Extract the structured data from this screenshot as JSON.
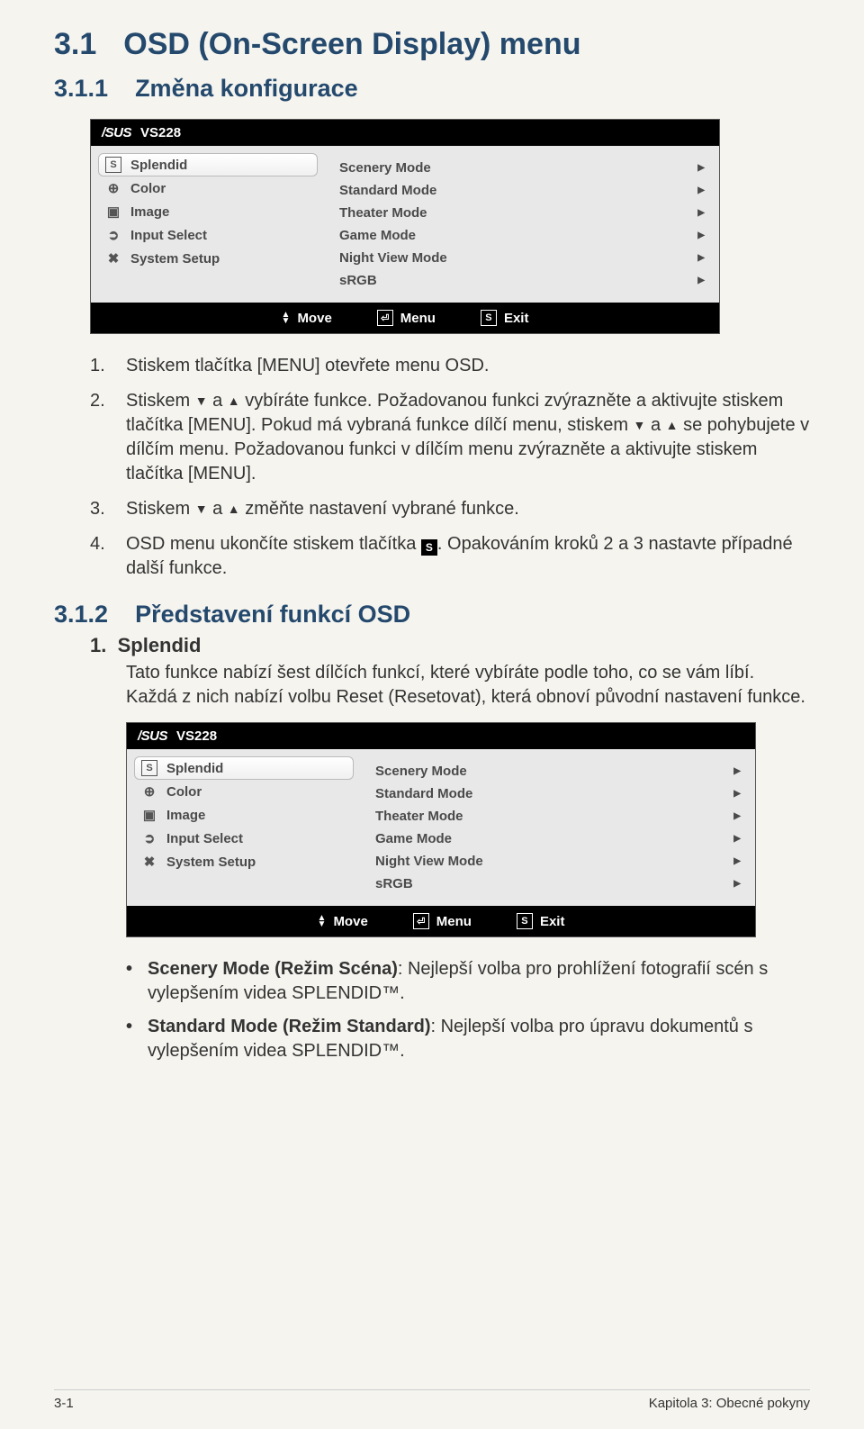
{
  "headings": {
    "h1_num": "3.1",
    "h1_text": "OSD (On-Screen Display) menu",
    "h2_num": "3.1.1",
    "h2_text": "Změna konfigurace",
    "h3_num": "3.1.2",
    "h3_text": "Představení funkcí OSD"
  },
  "osd": {
    "brand": "/SUS",
    "model": "VS228",
    "left": [
      {
        "icon": "S",
        "label": "Splendid",
        "selected": true
      },
      {
        "icon": "⊕",
        "label": "Color"
      },
      {
        "icon": "▣",
        "label": "Image"
      },
      {
        "icon": "➲",
        "label": "Input Select"
      },
      {
        "icon": "✖",
        "label": "System Setup"
      }
    ],
    "right": [
      "Scenery Mode",
      "Standard Mode",
      "Theater Mode",
      "Game Mode",
      "Night View Mode",
      "sRGB"
    ],
    "footer": {
      "move": "Move",
      "menu": "Menu",
      "exit": "Exit"
    }
  },
  "steps": {
    "s1": "Stiskem tlačítka [MENU] otevřete menu OSD.",
    "s2_a": "Stiskem ",
    "s2_b": " a ",
    "s2_c": " vybíráte funkce. Požadovanou funkci zvýrazněte a aktivujte stiskem tlačítka [MENU]. Pokud má vybraná funkce dílčí menu, stiskem ",
    "s2_d": " a ",
    "s2_e": " se pohybujete v dílčím menu. Požadovanou funkci v dílčím menu zvýrazněte a aktivujte stiskem tlačítka [MENU].",
    "s3_a": "Stiskem ",
    "s3_b": " a ",
    "s3_c": " změňte nastavení vybrané funkce.",
    "s4_a": "OSD menu ukončíte stiskem tlačítka ",
    "s4_b": ". Opakováním kroků 2 a 3 nastavte případné další funkce."
  },
  "splendid": {
    "num": "1.",
    "head": "Splendid",
    "body": "Tato funkce nabízí šest dílčích funkcí, které vybíráte podle toho, co se vám líbí. Každá z nich nabízí volbu Reset (Resetovat), která obnoví původní nastavení funkce."
  },
  "bullets": {
    "b1_bold": "Scenery Mode (Režim Scéna)",
    "b1_rest": ": Nejlepší volba pro prohlížení fotografií scén s vylepšením videa SPLENDID™.",
    "b2_bold": "Standard Mode (Režim Standard)",
    "b2_rest": ": Nejlepší volba pro úpravu dokumentů s vylepšením videa SPLENDID™."
  },
  "footer": {
    "left": "3-1",
    "right": "Kapitola 3: Obecné pokyny"
  }
}
